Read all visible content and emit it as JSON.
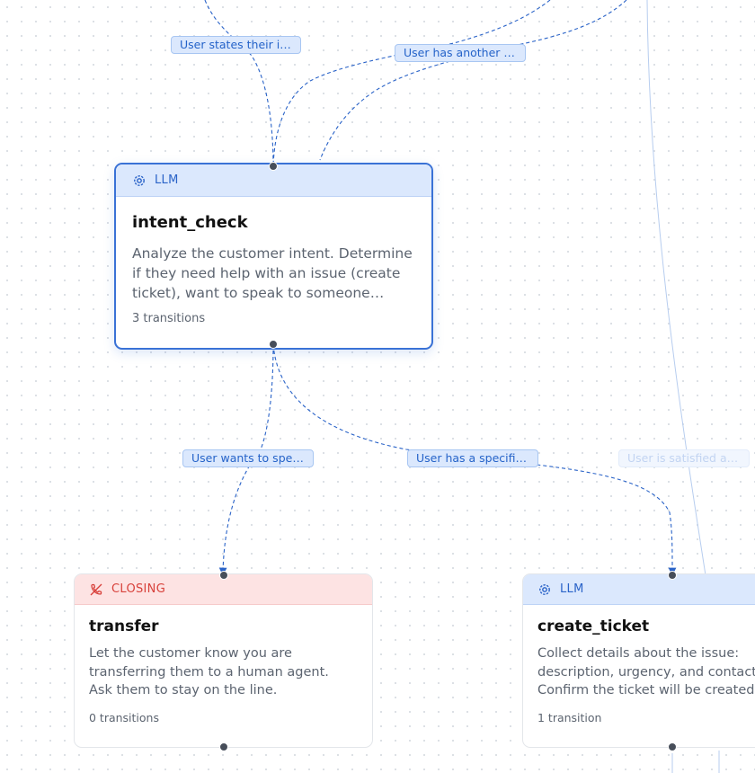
{
  "canvas": {
    "accent": "#3a72d6",
    "edge_color": "#2a63c8",
    "closing_color": "#d8413b"
  },
  "edge_labels": [
    {
      "text": "User states their i…"
    },
    {
      "text": "User has another …"
    },
    {
      "text": "User wants to spe…"
    },
    {
      "text": "User has a specifi…"
    },
    {
      "text": "User is satisfied a…"
    }
  ],
  "nodes": {
    "intent_check": {
      "type": "LLM",
      "icon": "llm-gear-icon",
      "title": "intent_check",
      "desc": [
        "Analyze the customer intent. Determine",
        "if they need help with an issue (create",
        "ticket), want to speak to someone…"
      ],
      "count": "3 transitions"
    },
    "transfer": {
      "type": "CLOSING",
      "icon": "phone-hangup-icon",
      "title": "transfer",
      "desc": [
        "Let the customer know you are",
        "transferring them to a human agent.",
        "Ask them to stay on the line."
      ],
      "count": "0 transitions"
    },
    "create_ticket": {
      "type": "LLM",
      "icon": "llm-gear-icon",
      "title": "create_ticket",
      "desc": [
        "Collect details about the issue:",
        "description, urgency, and contact",
        "Confirm the ticket will be created"
      ],
      "count": "1 transition"
    }
  }
}
